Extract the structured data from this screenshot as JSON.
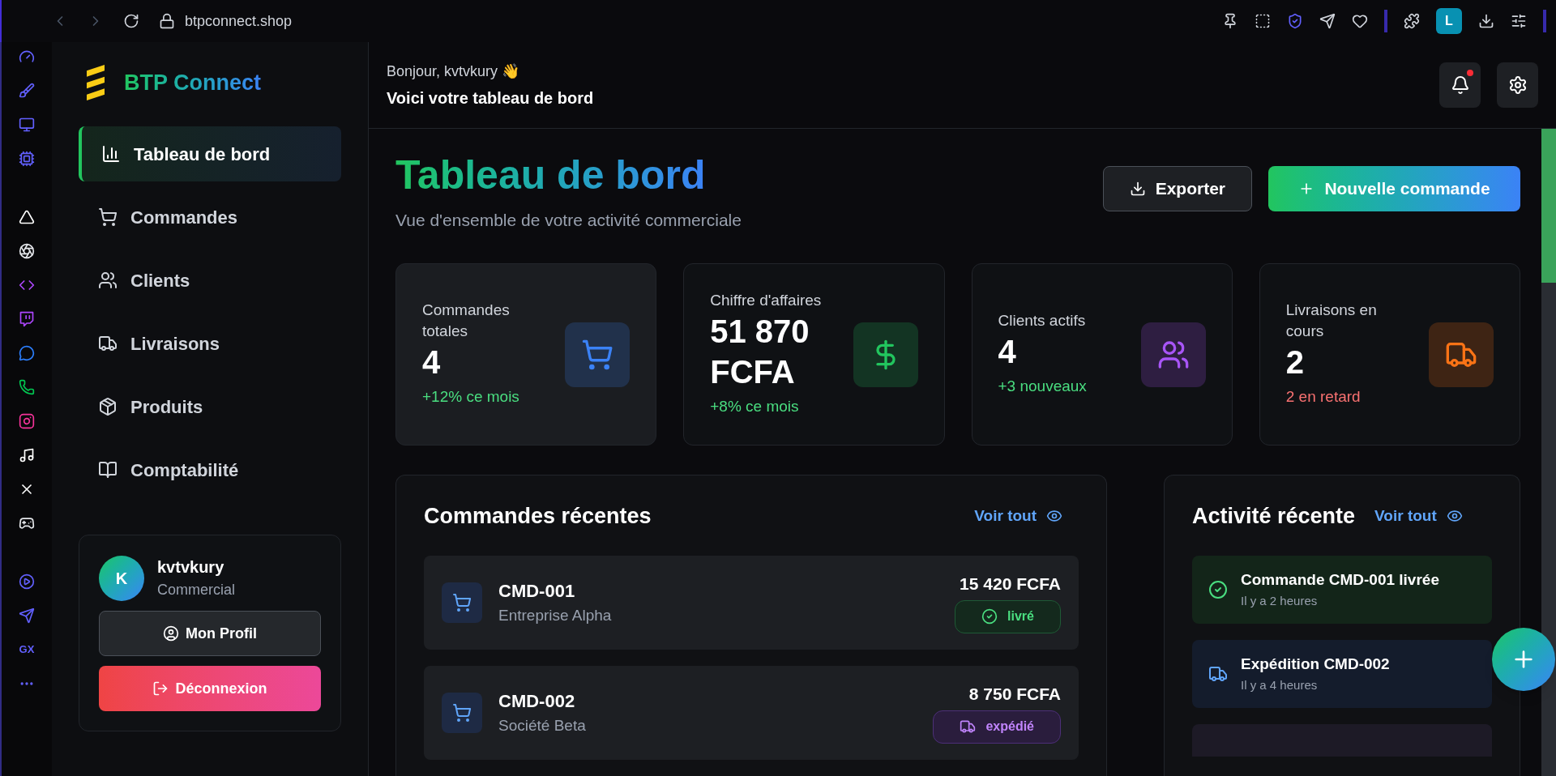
{
  "browser": {
    "url": "btpconnect.shop",
    "profile_initial": "L",
    "strip_label": "GX"
  },
  "sidebar": {
    "brand": "BTP Connect",
    "items": [
      {
        "label": "Tableau de bord",
        "selected": true
      },
      {
        "label": "Commandes",
        "selected": false
      },
      {
        "label": "Clients",
        "selected": false
      },
      {
        "label": "Livraisons",
        "selected": false
      },
      {
        "label": "Produits",
        "selected": false
      },
      {
        "label": "Comptabilité",
        "selected": false
      }
    ],
    "user": {
      "initial": "K",
      "name": "kvtvkury",
      "role": "Commercial",
      "profile_button": "Mon Profil",
      "logout_button": "Déconnexion"
    }
  },
  "header": {
    "greeting": "Bonjour, kvtvkury 👋",
    "subtitle": "Voici votre tableau de bord",
    "has_notification": true
  },
  "page": {
    "title": "Tableau de bord",
    "description": "Vue d'ensemble de votre activité commerciale",
    "export_button": "Exporter",
    "new_button": "Nouvelle commande"
  },
  "stats": [
    {
      "label": "Commandes totales",
      "value": "4",
      "trend": "+12% ce mois",
      "negative": false,
      "color": "#3b82f6",
      "highlighted": true
    },
    {
      "label": "Chiffre d'affaires",
      "value": "51 870 FCFA",
      "trend": "+8% ce mois",
      "negative": false,
      "color": "#22c55e",
      "highlighted": false
    },
    {
      "label": "Clients actifs",
      "value": "4",
      "trend": "+3 nouveaux",
      "negative": false,
      "color": "#a855f7",
      "highlighted": false
    },
    {
      "label": "Livraisons en cours",
      "value": "2",
      "trend": "2 en retard",
      "negative": true,
      "color": "#f97316",
      "highlighted": false
    }
  ],
  "recent_orders": {
    "title": "Commandes récentes",
    "link": "Voir tout",
    "rows": [
      {
        "id": "CMD-001",
        "client": "Entreprise Alpha",
        "amount": "15 420 FCFA",
        "status": "livré",
        "kind": "delivered"
      },
      {
        "id": "CMD-002",
        "client": "Société Beta",
        "amount": "8 750 FCFA",
        "status": "expédié",
        "kind": "shipped"
      }
    ]
  },
  "activity": {
    "title": "Activité récente",
    "link": "Voir tout",
    "items": [
      {
        "text": "Commande CMD-001 livrée",
        "time": "Il y a 2 heures",
        "kind": "delivered"
      },
      {
        "text": "Expédition CMD-002",
        "time": "Il y a 4 heures",
        "kind": "shipped"
      }
    ]
  }
}
